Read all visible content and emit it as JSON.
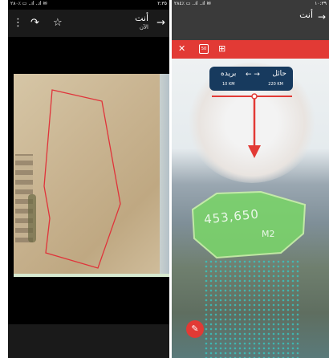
{
  "left_pane": {
    "status": {
      "time": "٢:٣٥",
      "left_info": "۲۸۰٪ ▭ ..ıl ..ıl ✉"
    },
    "topbar": {
      "title": "أنت",
      "subtitle": "الآن",
      "icons": [
        "more-vert-icon",
        "forward-icon",
        "star-icon",
        "back-arrow-icon"
      ]
    }
  },
  "right_pane": {
    "status": {
      "time": "١٠:٣٩",
      "left_info": "٢٨٤٪ ▭ ..ıl ..ıl ✉"
    },
    "topbar": {
      "title": "أنت"
    },
    "toolbar": {
      "icons": [
        "close-icon",
        "50-box-icon",
        "grid-icon"
      ],
      "box_label": "50"
    },
    "route": {
      "from": "حائل",
      "to": "بريده",
      "arrow": "←  →",
      "from_distance": "220 KM",
      "to_distance": "10 KM"
    },
    "field": {
      "number": "453,650",
      "unit": "M2"
    }
  },
  "colors": {
    "accent_red": "#e23a35",
    "route_box": "#173a5e",
    "field_green": "#7ad36a"
  }
}
